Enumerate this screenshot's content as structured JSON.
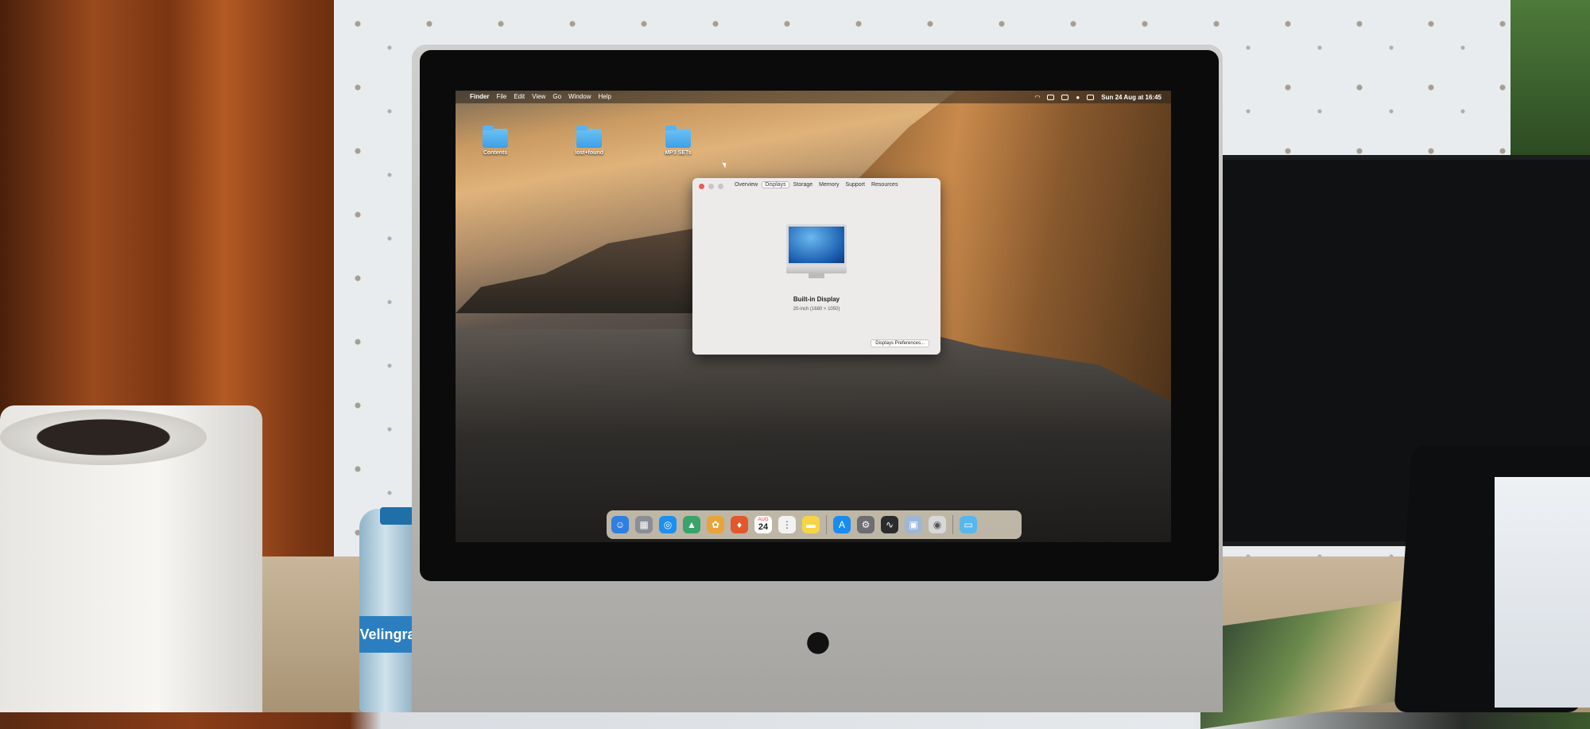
{
  "menubar": {
    "apple": "",
    "app_name": "Finder",
    "menus": [
      "File",
      "Edit",
      "View",
      "Go",
      "Window",
      "Help"
    ],
    "status_icons": [
      "wifi-icon",
      "input-icon",
      "display-icon",
      "user-icon",
      "control-center-icon"
    ],
    "datetime": "Sun 24 Aug at  16:45"
  },
  "desktop": {
    "icons": [
      {
        "label": "Contents",
        "icon": "folder-icon"
      },
      {
        "label": "lost+found",
        "icon": "folder-icon"
      },
      {
        "label": "MP3 SETs",
        "icon": "folder-icon"
      }
    ]
  },
  "about_window": {
    "tabs": [
      "Overview",
      "Displays",
      "Storage",
      "Memory",
      "Support",
      "Resources"
    ],
    "active_tab": "Displays",
    "display_name": "Built-in Display",
    "display_spec": "20-inch (1680 × 1050)",
    "prefs_button": "Displays Preferences..."
  },
  "dock": {
    "apps": [
      {
        "name": "finder-icon",
        "glyph": "☺",
        "color": "#2f7fe0"
      },
      {
        "name": "launchpad-icon",
        "glyph": "▦",
        "color": "#8a8f96"
      },
      {
        "name": "safari-icon",
        "glyph": "◎",
        "color": "#1e8ff0"
      },
      {
        "name": "altstore-icon",
        "glyph": "▲",
        "color": "#3aa36b"
      },
      {
        "name": "photos-icon",
        "glyph": "✿",
        "color": "#e8a33a"
      },
      {
        "name": "brave-icon",
        "glyph": "♦",
        "color": "#e2572b"
      },
      {
        "name": "calendar-icon",
        "glyph": "",
        "color": "#ffffff"
      },
      {
        "name": "reminders-icon",
        "glyph": "⋮",
        "color": "#f2f2f2"
      },
      {
        "name": "notes-icon",
        "glyph": "▬",
        "color": "#f5d547"
      },
      {
        "name": "app-store-icon",
        "glyph": "A",
        "color": "#1a8cf0"
      },
      {
        "name": "system-preferences-icon",
        "glyph": "⚙",
        "color": "#6d6d72"
      },
      {
        "name": "activity-monitor-icon",
        "glyph": "∿",
        "color": "#2b2b2b"
      },
      {
        "name": "preview-icon",
        "glyph": "▣",
        "color": "#9db7d8"
      },
      {
        "name": "disk-utility-icon",
        "glyph": "◉",
        "color": "#d8d8d8"
      },
      {
        "name": "downloads-folder-icon",
        "glyph": "▭",
        "color": "#58b6ee"
      }
    ],
    "calendar": {
      "month": "AUG",
      "day": "24"
    }
  },
  "hardware": {
    "bottle_label": "Velingrad"
  }
}
